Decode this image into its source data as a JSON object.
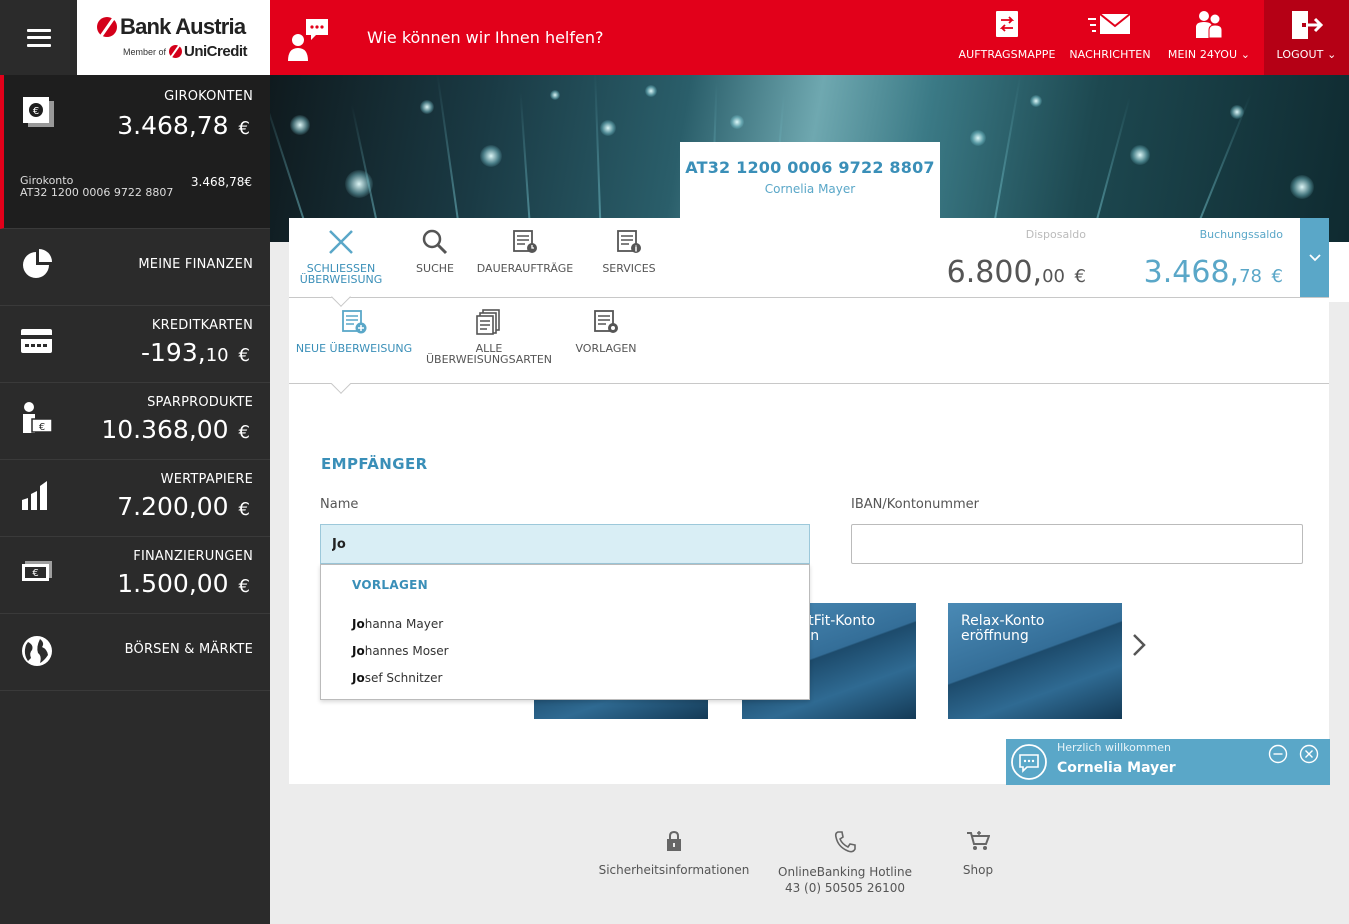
{
  "header": {
    "brand": "Bank Austria",
    "member_of": "Member of",
    "group": "UniCredit",
    "help": "Wie können wir Ihnen helfen?",
    "nav": [
      {
        "label": "AUFTRAGSMAPPE",
        "icon": "transfer-folder-icon"
      },
      {
        "label": "NACHRICHTEN",
        "icon": "envelope-icon"
      },
      {
        "label": "MEIN 24YOU",
        "icon": "people-icon"
      },
      {
        "label": "LOGOUT",
        "icon": "logout-icon"
      }
    ]
  },
  "sidebar": {
    "giro": {
      "title": "GIROKONTEN",
      "amount_int": "3.468,",
      "amount_dec": "78",
      "currency": "€",
      "sub_name": "Girokonto",
      "sub_iban": "AT32 1200 0006 9722 8807",
      "sub_amount": "3.468,78€"
    },
    "items": [
      {
        "title": "MEINE FINANZEN",
        "icon": "pie-chart-icon"
      },
      {
        "title": "KREDITKARTEN",
        "amount_int": "-193,",
        "amount_dec": "10",
        "currency": "€",
        "icon": "credit-card-icon"
      },
      {
        "title": "SPARPRODUKTE",
        "amount_int": "10.368,",
        "amount_dec": "00",
        "currency": "€",
        "icon": "savings-icon"
      },
      {
        "title": "WERTPAPIERE",
        "amount_int": "7.200,",
        "amount_dec": "00",
        "currency": "€",
        "icon": "bar-chart-icon"
      },
      {
        "title": "FINANZIERUNGEN",
        "amount_int": "1.500,",
        "amount_dec": "00",
        "currency": "€",
        "icon": "banknote-icon"
      },
      {
        "title": "BÖRSEN & MÄRKTE",
        "icon": "globe-icon"
      }
    ]
  },
  "account": {
    "iban": "AT32 1200 0006 9722 8807",
    "owner": "Cornelia Mayer"
  },
  "tabs": [
    {
      "label_1": "SCHLIESSEN",
      "label_2": "ÜBERWEISUNG",
      "icon": "close-icon"
    },
    {
      "label_1": "SUCHE",
      "icon": "search-icon"
    },
    {
      "label_1": "DAUERAUFTRÄGE",
      "icon": "standing-order-icon"
    },
    {
      "label_1": "SERVICES",
      "icon": "services-icon"
    }
  ],
  "balances": {
    "dispo_label": "Disposaldo",
    "dispo_int": "6.800,",
    "dispo_dec": "00",
    "dispo_cur": "€",
    "booking_label": "Buchungssaldo",
    "booking_int": "3.468,",
    "booking_dec": "78",
    "booking_cur": "€"
  },
  "subtabs": [
    {
      "label_1": "NEUE ÜBERWEISUNG",
      "icon": "new-transfer-icon"
    },
    {
      "label_1": "ALLE",
      "label_2": "ÜBERWEISUNGSARTEN",
      "icon": "all-transfer-types-icon"
    },
    {
      "label_1": "VORLAGEN",
      "icon": "templates-icon"
    }
  ],
  "form": {
    "section_title": "EMPFÄNGER",
    "name_label": "Name",
    "name_value": "Jo",
    "iban_label": "IBAN/Kontonummer",
    "iban_value": ""
  },
  "dropdown": {
    "header": "VORLAGEN",
    "items": [
      {
        "match": "Jo",
        "rest": "hanna Mayer"
      },
      {
        "match": "Jo",
        "rest": "hannes Moser"
      },
      {
        "match": "Jo",
        "rest": "sef Schnitzer"
      }
    ]
  },
  "promos": [
    {
      "title_1": "",
      "title_2": ""
    },
    {
      "title_1": "ectFit-Konto",
      "title_2": "ffen"
    },
    {
      "title_1": "Relax-Konto",
      "title_2": "eröffnung"
    }
  ],
  "chat": {
    "greeting": "Herzlich willkommen",
    "name": "Cornelia Mayer"
  },
  "footer": [
    {
      "label_1": "Sicherheitsinformationen",
      "label_2": "",
      "icon": "lock-icon"
    },
    {
      "label_1": "OnlineBanking Hotline",
      "label_2": "43 (0) 50505 26100",
      "icon": "phone-icon"
    },
    {
      "label_1": "Shop",
      "label_2": "",
      "icon": "cart-icon"
    }
  ]
}
